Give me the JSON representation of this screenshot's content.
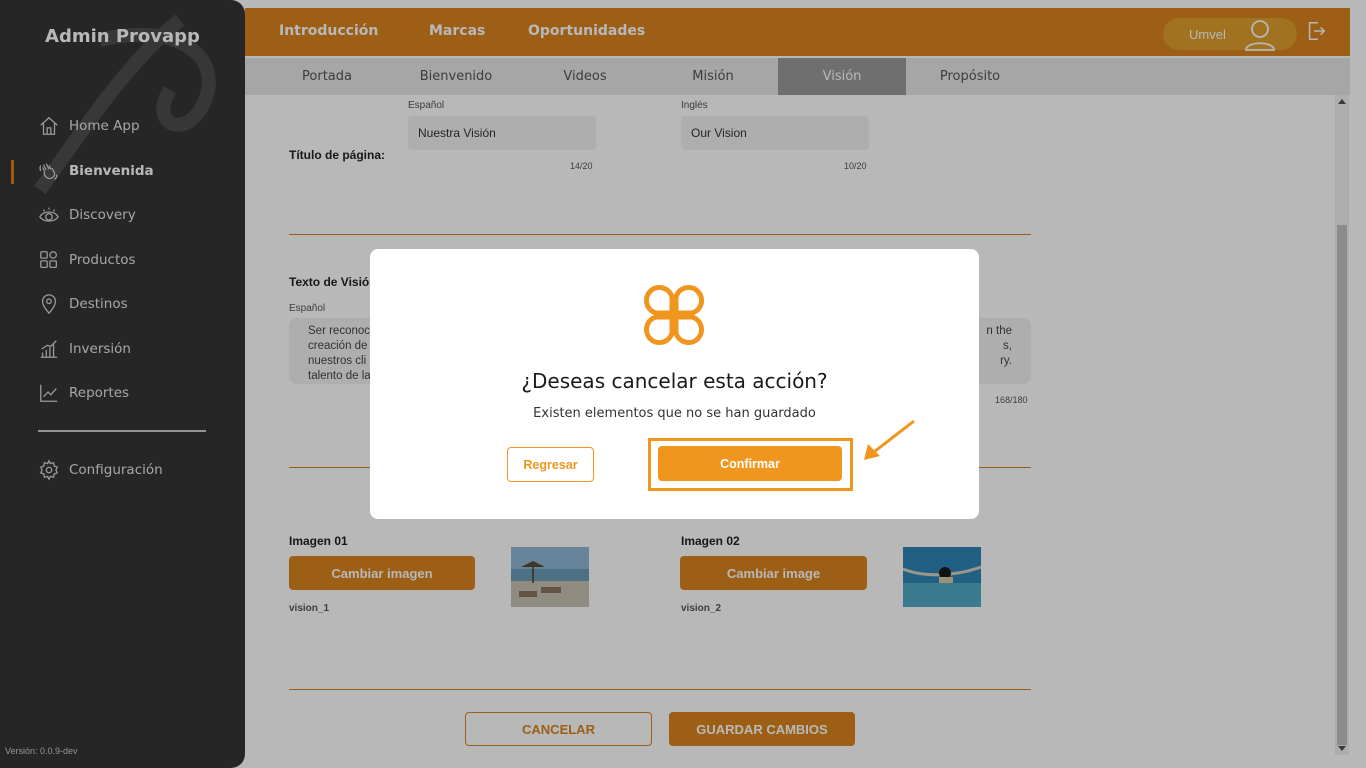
{
  "sidebar": {
    "brand": "Admin Provapp",
    "items": [
      {
        "label": "Home App",
        "icon": "home-icon"
      },
      {
        "label": "Bienvenida",
        "icon": "hand-wave-icon",
        "active": true
      },
      {
        "label": "Discovery",
        "icon": "eye-icon"
      },
      {
        "label": "Productos",
        "icon": "grid-icon"
      },
      {
        "label": "Destinos",
        "icon": "location-pin-icon"
      },
      {
        "label": "Inversión",
        "icon": "bar-chart-icon"
      },
      {
        "label": "Reportes",
        "icon": "line-chart-icon"
      }
    ],
    "settings": {
      "label": "Configuración",
      "icon": "gear-icon"
    },
    "version": "Versión: 0.0.9-dev"
  },
  "header": {
    "tabs": [
      "Introducción",
      "Marcas",
      "Oportunidades"
    ],
    "user": "Umvel"
  },
  "subtabs": [
    "Portada",
    "Bienvenido",
    "Videos",
    "Misión",
    "Visión",
    "Propósito"
  ],
  "subtabs_active": "Visión",
  "form": {
    "page_title_label": "Título de página:",
    "lang_es": "Español",
    "lang_en": "Inglés",
    "title_es": "Nuestra Visión",
    "title_en": "Our Vision",
    "title_es_count": "14/20",
    "title_en_count": "10/20",
    "vision_text_label": "Texto de Visió",
    "vision_lang_es": "Español",
    "vision_text_es": "Ser reconoc\ncreación de\nnuestros cli\ntalento de la",
    "vision_text_en": "n the\ns,\nry.",
    "vision_count": "168/180",
    "image1_label": "Imagen 01",
    "image1_btn": "Cambiar imagen",
    "image1_name": "vision_1",
    "image2_label": "Imagen 02",
    "image2_btn": "Cambiar image",
    "image2_name": "vision_2",
    "cancel": "CANCELAR",
    "save": "GUARDAR CAMBIOS"
  },
  "modal": {
    "title": "¿Deseas cancelar esta acción?",
    "subtitle": "Existen elementos que no se han guardado",
    "back": "Regresar",
    "confirm": "Confirmar"
  },
  "colors": {
    "accent": "#d8841e",
    "modal_accent": "#f0961e",
    "sidebar_bg": "#353535"
  }
}
